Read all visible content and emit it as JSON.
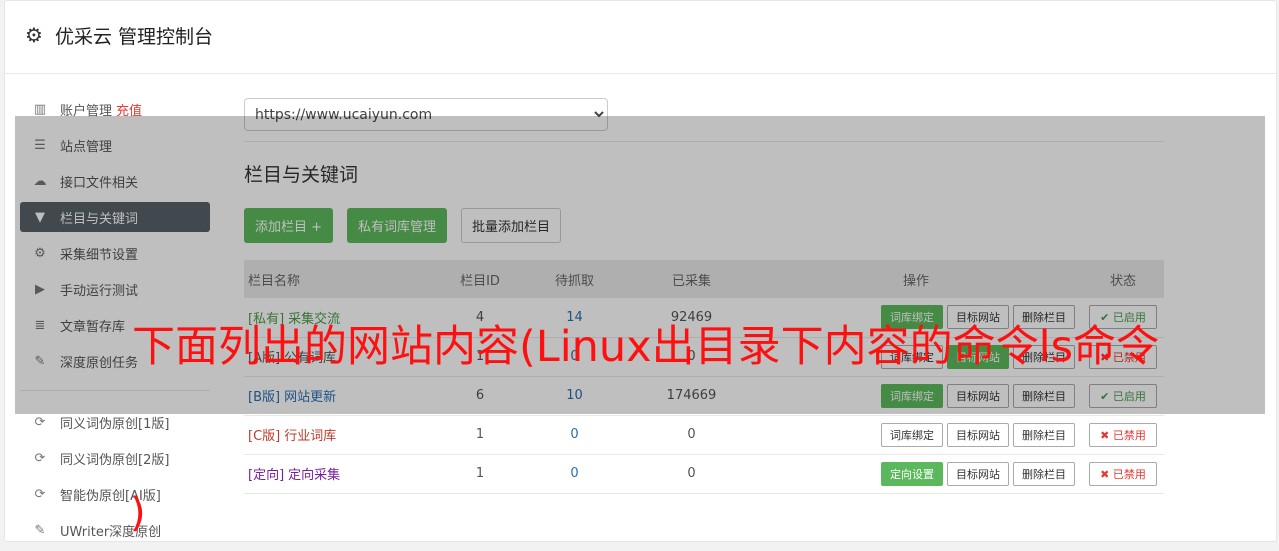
{
  "header": {
    "icon": "gear-icon",
    "title": "优采云 管理控制台"
  },
  "sidebar": {
    "items": [
      {
        "icon": "bar-chart-icon",
        "glyph": "▥",
        "label": "账户管理",
        "badge": "充值"
      },
      {
        "icon": "server-icon",
        "glyph": "☰",
        "label": "站点管理"
      },
      {
        "icon": "cloud-upload-icon",
        "glyph": "☁",
        "label": "接口文件相关"
      },
      {
        "icon": "filter-icon",
        "glyph": "▼",
        "label": "栏目与关键词",
        "active": true
      },
      {
        "icon": "cogs-icon",
        "glyph": "⚙",
        "label": "采集细节设置"
      },
      {
        "icon": "play-circle-icon",
        "glyph": "▶",
        "label": "手动运行测试"
      },
      {
        "icon": "database-icon",
        "glyph": "≣",
        "label": "文章暂存库"
      },
      {
        "icon": "edit-icon",
        "glyph": "✎",
        "label": "深度原创任务"
      },
      {
        "icon": "refresh-icon",
        "glyph": "⟳",
        "label": "同义词伪原创[1版]"
      },
      {
        "icon": "refresh-icon",
        "glyph": "⟳",
        "label": "同义词伪原创[2版]"
      },
      {
        "icon": "refresh-icon",
        "glyph": "⟳",
        "label": "智能伪原创[AI版]"
      },
      {
        "icon": "edit-icon",
        "glyph": "✎",
        "label": "UWriter深度原创"
      }
    ]
  },
  "site_select": {
    "value": "https://www.ucaiyun.com"
  },
  "section": {
    "title": "栏目与关键词"
  },
  "buttons": {
    "add": "添加栏目 +",
    "private": "私有词库管理",
    "batch": "批量添加栏目"
  },
  "table": {
    "headers": [
      "栏目名称",
      "栏目ID",
      "待抓取",
      "已采集",
      "操作",
      "状态"
    ],
    "rows": [
      {
        "tag": "[私有]",
        "tag_color": "#4a9c4a",
        "name": "采集交流",
        "name_color": "#4a9c4a",
        "id": "4",
        "pending": "14",
        "collected": "92469",
        "op1": "词库绑定",
        "op1_green": true,
        "op2": "目标网站",
        "op2_green": false,
        "op3": "删除栏目",
        "status": "✔ 已启用",
        "status_on": true
      },
      {
        "tag": "[A版]",
        "tag_color": "#555555",
        "name": "公有词库",
        "name_color": "#555555",
        "id": "1",
        "pending": "0",
        "collected": "0",
        "op1": "词库绑定",
        "op1_green": false,
        "op2": "目标网站",
        "op2_green": true,
        "op3": "删除栏目",
        "status": "✖ 已禁用",
        "status_on": false
      },
      {
        "tag": "[B版]",
        "tag_color": "#2a6fb0",
        "name": "网站更新",
        "name_color": "#2a6fb0",
        "id": "6",
        "pending": "10",
        "collected": "174669",
        "op1": "词库绑定",
        "op1_green": true,
        "op2": "目标网站",
        "op2_green": false,
        "op3": "删除栏目",
        "status": "✔ 已启用",
        "status_on": true
      },
      {
        "tag": "[C版]",
        "tag_color": "#c0392b",
        "name": "行业词库",
        "name_color": "#c0392b",
        "id": "1",
        "pending": "0",
        "collected": "0",
        "op1": "词库绑定",
        "op1_green": false,
        "op2": "目标网站",
        "op2_green": false,
        "op3": "删除栏目",
        "status": "✖ 已禁用",
        "status_on": false
      },
      {
        "tag": "[定向]",
        "tag_color": "#7b1fa2",
        "name": "定向采集",
        "name_color": "#7b1fa2",
        "id": "1",
        "pending": "0",
        "collected": "0",
        "op1": "定向设置",
        "op1_green": true,
        "op2": "目标网站",
        "op2_green": false,
        "op3": "删除栏目",
        "status": "✖ 已禁用",
        "status_on": false
      }
    ]
  },
  "overlay": {
    "text": "下面列出的网站内容(Linux出目录下内容的命令ls命令",
    "paren": ")"
  }
}
